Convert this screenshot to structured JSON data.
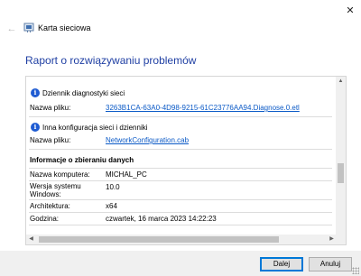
{
  "window": {
    "title": "Karta sieciowa",
    "close_glyph": "✕",
    "back_glyph": "←"
  },
  "report": {
    "title": "Raport o rozwiązywaniu problemów",
    "sections": [
      {
        "icon": "info-icon",
        "title": "Dziennik diagnostyki sieci",
        "file_label": "Nazwa pliku:",
        "file_name": "3263B1CA-63A0-4D98-9215-61C23776AA94.Diagnose.0.etl"
      },
      {
        "icon": "info-icon",
        "title": "Inna konfiguracja sieci i dzienniki",
        "file_label": "Nazwa pliku:",
        "file_name": "NetworkConfiguration.cab"
      }
    ],
    "collection": {
      "header": "Informacje o zbieraniu danych",
      "rows": [
        {
          "label": "Nazwa komputera:",
          "value": "MICHAL_PC"
        },
        {
          "label": "Wersja systemu Windows:",
          "value": "10.0"
        },
        {
          "label": "Architektura:",
          "value": "x64"
        },
        {
          "label": "Godzina:",
          "value": "czwartek, 16 marca 2023 14:22:23"
        }
      ]
    }
  },
  "buttons": {
    "next": "Dalej",
    "cancel": "Anuluj"
  },
  "colors": {
    "title_blue": "#1f3fa3",
    "link_blue": "#0a59c6",
    "info_icon_blue": "#1e5bd2",
    "default_button_border": "#0078d7"
  }
}
